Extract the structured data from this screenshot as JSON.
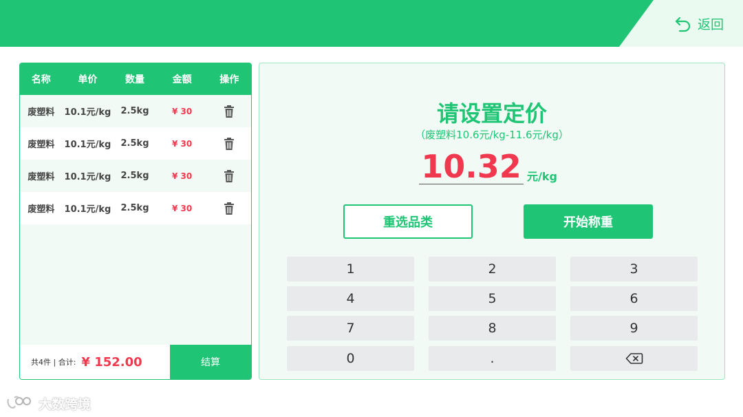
{
  "header": {
    "back_label": "返回"
  },
  "table": {
    "columns": [
      "名称",
      "单价",
      "数量",
      "金额",
      "操作"
    ],
    "rows": [
      {
        "name": "废塑料",
        "unit_price": "10.1元/kg",
        "qty": "2.5kg",
        "amount": "¥ 30"
      },
      {
        "name": "废塑料",
        "unit_price": "10.1元/kg",
        "qty": "2.5kg",
        "amount": "¥ 30"
      },
      {
        "name": "废塑料",
        "unit_price": "10.1元/kg",
        "qty": "2.5kg",
        "amount": "¥ 30"
      },
      {
        "name": "废塑料",
        "unit_price": "10.1元/kg",
        "qty": "2.5kg",
        "amount": "¥ 30"
      }
    ]
  },
  "footer": {
    "count_label": "共4件 | 合计:",
    "total": "¥ 152.00",
    "checkout_label": "结算"
  },
  "pricing": {
    "title": "请设置定价",
    "range": "（废塑料10.6元/kg-11.6元/kg）",
    "value": "10.32",
    "unit": "元/kg",
    "reselect_label": "重选品类",
    "start_weigh_label": "开始称重"
  },
  "keypad": {
    "keys": [
      "1",
      "2",
      "3",
      "4",
      "5",
      "6",
      "7",
      "8",
      "9",
      "0",
      "."
    ]
  },
  "watermark": {
    "text": "大数跨境"
  },
  "colors": {
    "brand": "#1fc575",
    "amount": "#f0384f",
    "panel_bg": "#f1faf5",
    "key_bg": "#e9eaec"
  },
  "icons": {
    "back": "undo-arrow-icon",
    "delete": "trash-icon",
    "backspace": "backspace-icon"
  }
}
